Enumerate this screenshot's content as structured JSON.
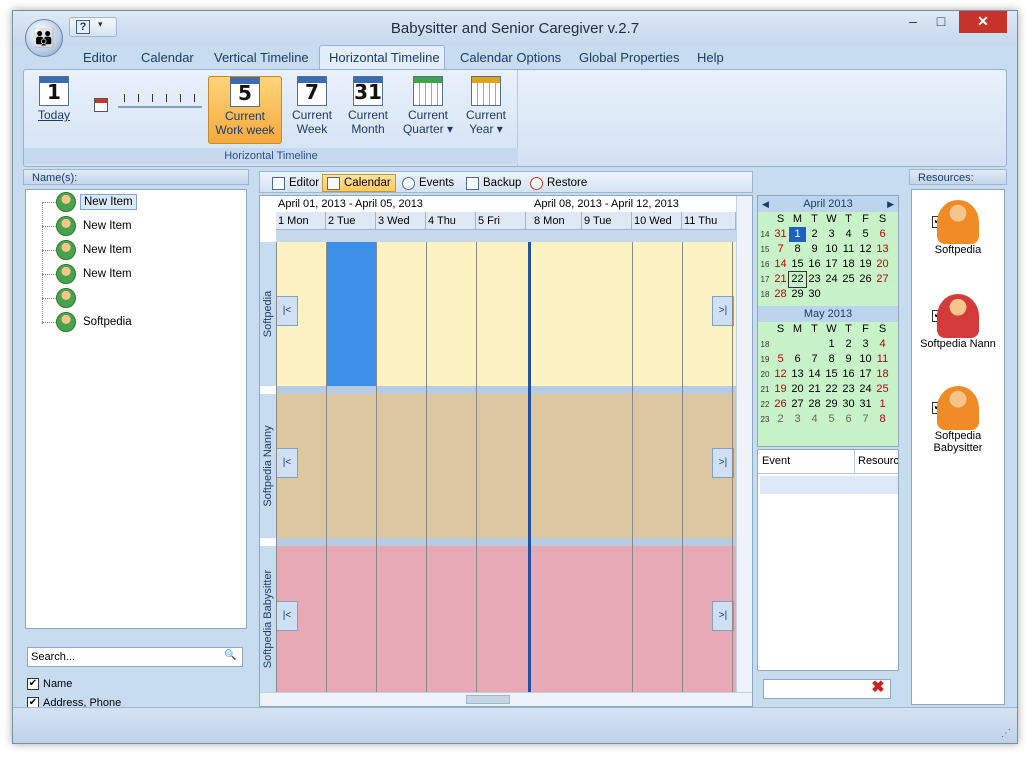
{
  "window": {
    "title": "Babysitter and Senior Caregiver v.2.7",
    "min": "–",
    "max": "□",
    "close": "✕"
  },
  "qat": {
    "help": "?",
    "dropdown": "▾"
  },
  "menu": [
    "Editor",
    "Calendar",
    "Vertical Timeline",
    "Horizontal Timeline",
    "Calendar Options",
    "Global Properties",
    "Help"
  ],
  "ribbon": {
    "group_caption": "Horizontal Timeline",
    "today": {
      "icon_num": "1",
      "label": "Today"
    },
    "buttons": [
      {
        "icon_num": "5",
        "line1": "Current",
        "line2": "Work week"
      },
      {
        "icon_num": "7",
        "line1": "Current",
        "line2": "Week"
      },
      {
        "icon_num": "31",
        "line1": "Current",
        "line2": "Month"
      },
      {
        "icon_num": "",
        "line1": "Current",
        "line2": "Quarter ▾"
      },
      {
        "icon_num": "",
        "line1": "Current",
        "line2": "Year ▾"
      }
    ]
  },
  "left": {
    "header": "Name(s):",
    "items": [
      "New Item",
      "New Item",
      "New Item",
      "New Item",
      "",
      "Softpedia"
    ],
    "search_placeholder": "Search...",
    "search_btn": "🔍",
    "checks": [
      {
        "label": "Name",
        "mark": "✔"
      },
      {
        "label": "Address, Phone",
        "mark": "✔"
      }
    ]
  },
  "center": {
    "toolbar": [
      "Editor",
      "Calendar",
      "Events",
      "Backup",
      "Restore"
    ],
    "range1": "April 01, 2013 - April 05, 2013",
    "range2": "April 08, 2013 - April 12, 2013",
    "days1": [
      "1 Mon",
      "2 Tue",
      "3 Wed",
      "4 Thu",
      "5 Fri"
    ],
    "days2": [
      "8 Mon",
      "9 Tue",
      "10 Wed",
      "11 Thu"
    ],
    "rows": [
      "Softpedia",
      "Softpedia Nanny",
      "Softpedia Babysitter"
    ],
    "row_colors": [
      "#fdf2c2",
      "#dcc7a0",
      "#e7aab5"
    ],
    "prev": "|<",
    "next": ">|"
  },
  "minical": {
    "april": {
      "title": "April 2013",
      "prev": "◀",
      "next": "▶"
    },
    "may": {
      "title": "May 2013"
    },
    "dow": [
      "S",
      "M",
      "T",
      "W",
      "T",
      "F",
      "S"
    ]
  },
  "events": {
    "col1": "Event",
    "col2": "Resource",
    "clear": "✖"
  },
  "right": {
    "header": "Resources:",
    "items": [
      {
        "name": "Softpedia",
        "mark": "✔"
      },
      {
        "name": "Softpedia Nann",
        "mark": "✔"
      },
      {
        "name": "Softpedia Babysitter",
        "mark": "✔"
      }
    ]
  },
  "colors": {
    "accent": "#f6a93e",
    "today": "#1f5fc2",
    "selected_column": "#3d8fe8"
  }
}
